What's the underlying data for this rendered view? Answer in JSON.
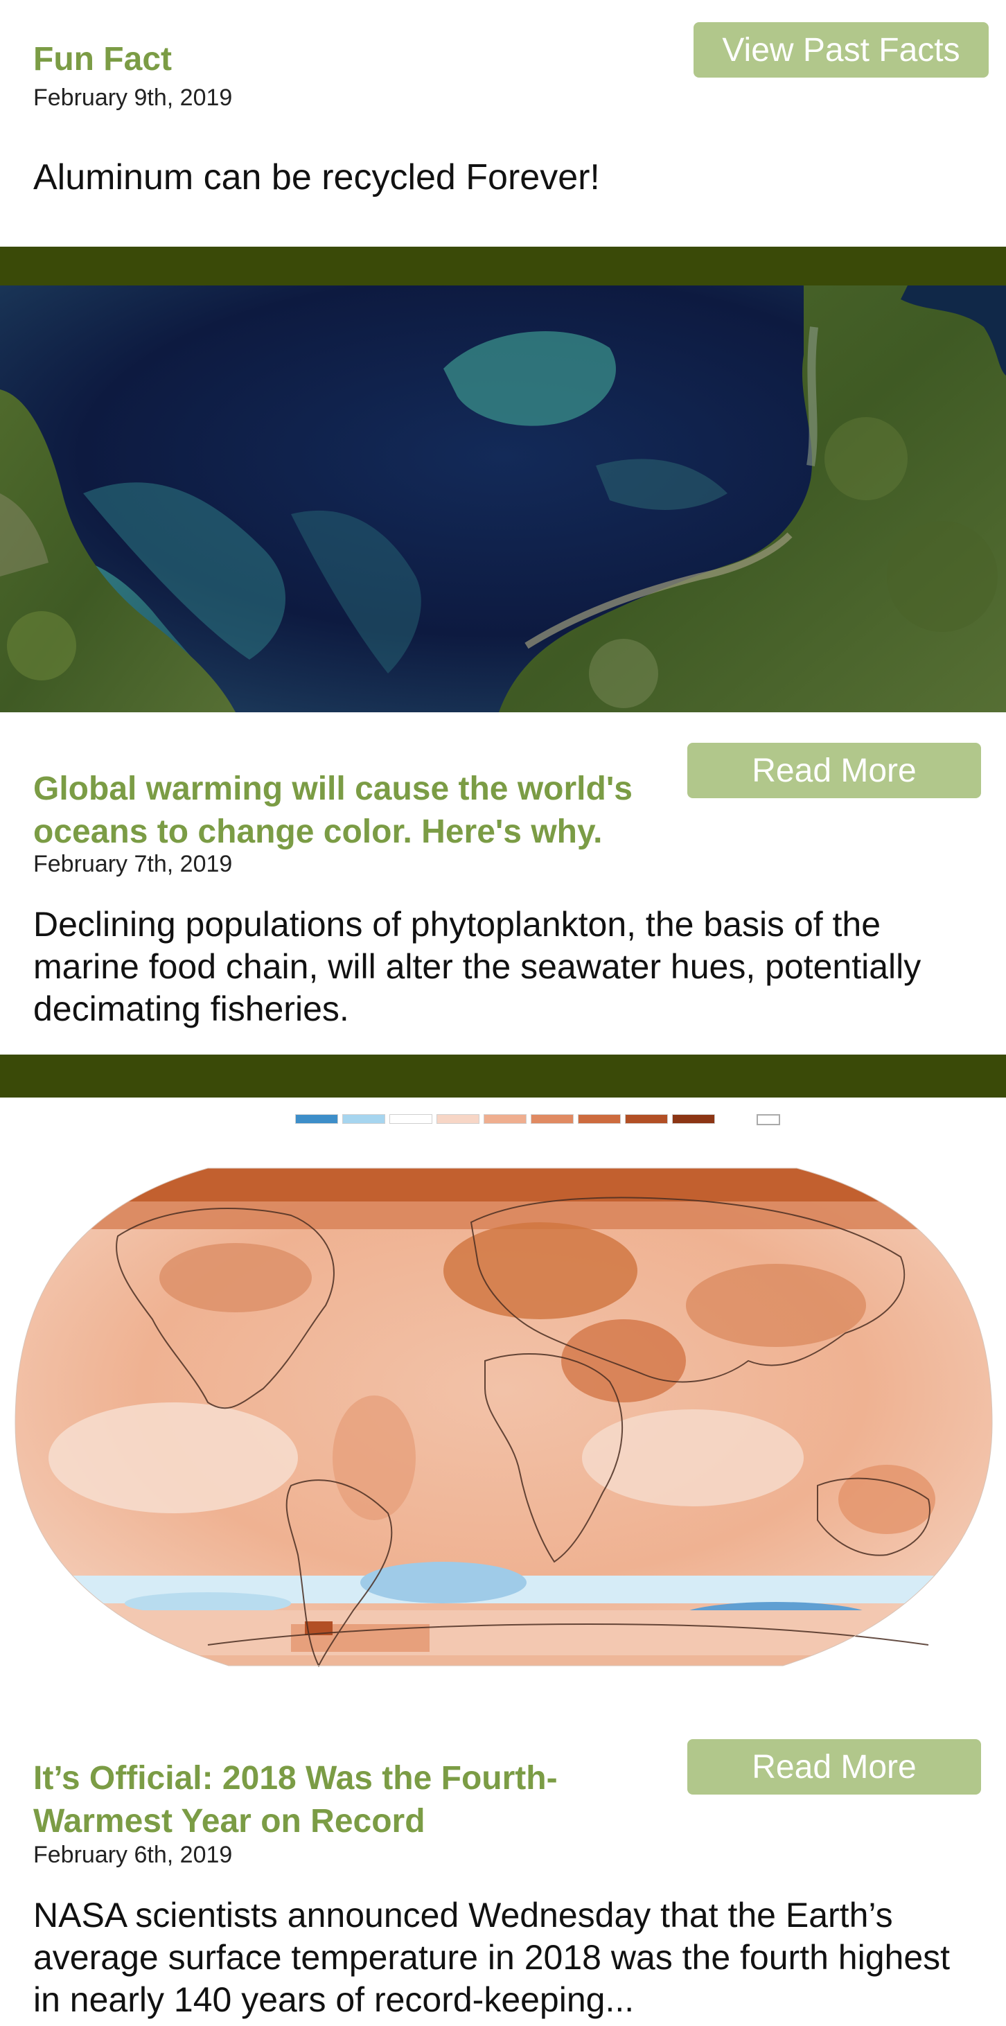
{
  "fun_fact": {
    "heading": "Fun Fact",
    "date": "February 9th, 2019",
    "text": "Aluminum can be recycled Forever!",
    "past_button": "View Past Facts"
  },
  "articles": [
    {
      "title": "Global warming will cause the world's oceans to change color. Here's why.",
      "date": "February 7th, 2019",
      "summary": "Declining populations of phytoplankton, the basis of the marine food chain, will alter the seawater hues, potentially decimating fisheries.",
      "read_more": "Read More",
      "image": "satellite-ocean-bloom"
    },
    {
      "title": "It’s Official: 2018 Was the Fourth-Warmest Year on Record",
      "date": "February 6th, 2019",
      "summary": "NASA scientists announced Wednesday that the Earth’s average surface temperature in 2018 was the fourth highest in nearly 140 years of record-keeping...",
      "read_more": "Read More",
      "image": "global-temperature-anomaly-map"
    }
  ],
  "map_legend": {
    "colors": [
      "#3d8ec9",
      "#a6d5ef",
      "#ffffff",
      "#f7d6c6",
      "#efae8f",
      "#e08a62",
      "#cd6b3e",
      "#b24f25",
      "#8c3514"
    ],
    "no_data_color": "#ffffff"
  },
  "theme": {
    "accent": "#7b9c45",
    "button": "#b1c78b",
    "divider": "#3a4a08"
  }
}
